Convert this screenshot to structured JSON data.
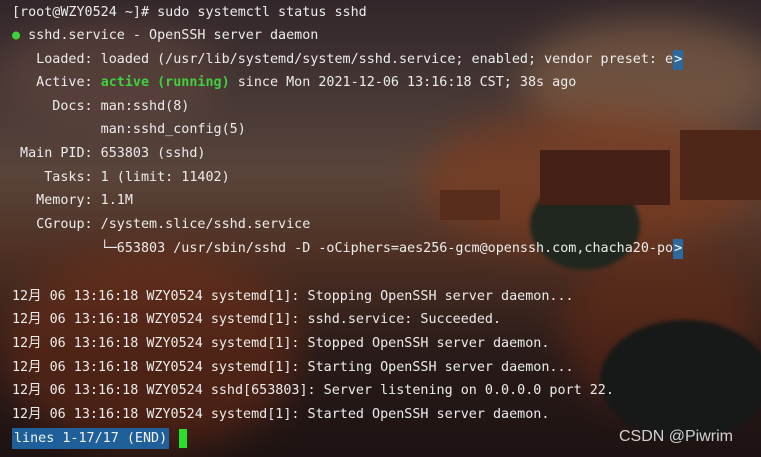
{
  "terminal": {
    "prompt": "[root@WZY0524 ~]# sudo systemctl status sshd",
    "unit_dot": "●",
    "unit_title": " sshd.service - OpenSSH server daemon",
    "loaded": "   Loaded: loaded (/usr/lib/systemd/system/sshd.service; enabled; vendor preset: e",
    "active_label": "   Active: ",
    "active_state": "active (running)",
    "active_rest": " since Mon 2021-12-06 13:16:18 CST; 38s ago",
    "docs1": "     Docs: man:sshd(8)",
    "docs2": "           man:sshd_config(5)",
    "main_pid": " Main PID: 653803 (sshd)",
    "tasks": "    Tasks: 1 (limit: 11402)",
    "memory": "   Memory: 1.1M",
    "cgroup": "   CGroup: /system.slice/sshd.service",
    "cgroup_child": "           └─653803 /usr/sbin/sshd -D -oCiphers=aes256-gcm@openssh.com,chacha20-po",
    "truncation_marker": ">",
    "log": [
      "12月 06 13:16:18 WZY0524 systemd[1]: Stopping OpenSSH server daemon...",
      "12月 06 13:16:18 WZY0524 systemd[1]: sshd.service: Succeeded.",
      "12月 06 13:16:18 WZY0524 systemd[1]: Stopped OpenSSH server daemon.",
      "12月 06 13:16:18 WZY0524 systemd[1]: Starting OpenSSH server daemon...",
      "12月 06 13:16:18 WZY0524 sshd[653803]: Server listening on 0.0.0.0 port 22.",
      "12月 06 13:16:18 WZY0524 systemd[1]: Started OpenSSH server daemon."
    ],
    "pager_status": "lines 1-17/17 (END)"
  },
  "watermark": "CSDN @Piwrim",
  "colors": {
    "active_green": "#3ed13e",
    "status_bar": "#1f5f9a",
    "cursor": "#2adf2a"
  }
}
